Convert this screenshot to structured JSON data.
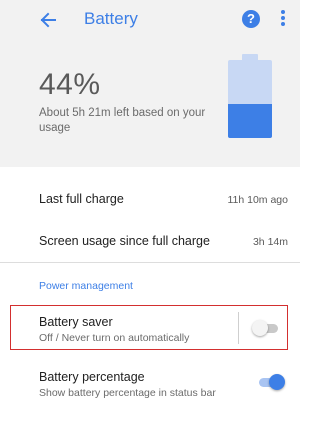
{
  "appbar": {
    "title": "Battery",
    "back_icon": "arrow-left-icon",
    "help_icon": "help-circle-icon",
    "help_glyph": "?",
    "more_icon": "more-vert-icon"
  },
  "status": {
    "percent_label": "44%",
    "level_fraction": 0.44,
    "remaining_text": "About 5h 21m left based on your usage"
  },
  "stats": [
    {
      "label": "Last full charge",
      "value": "11h 10m ago"
    },
    {
      "label": "Screen usage since full charge",
      "value": "3h 14m"
    }
  ],
  "power_management": {
    "header": "Power management",
    "battery_saver": {
      "title": "Battery saver",
      "summary": "Off / Never turn on automatically",
      "enabled": false
    },
    "battery_percentage": {
      "title": "Battery percentage",
      "summary": "Show battery percentage in status bar",
      "enabled": true
    }
  },
  "colors": {
    "accent": "#3d7fe6",
    "battery_empty": "#c8d8f4",
    "header_bg": "#f2f2f2",
    "highlight_border": "#d32f2f"
  }
}
